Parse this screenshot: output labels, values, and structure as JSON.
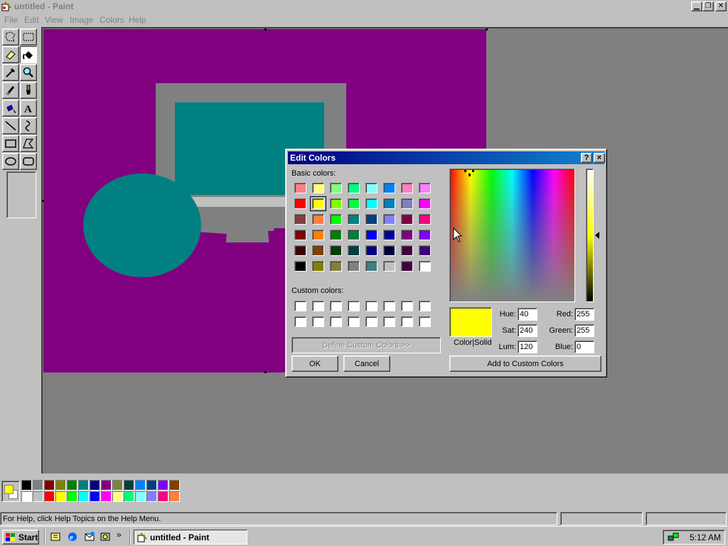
{
  "window": {
    "title": "untitled - Paint",
    "menu": [
      "File",
      "Edit",
      "View",
      "Image",
      "Colors",
      "Help"
    ]
  },
  "toolbox": {
    "tools": [
      "free-form-select",
      "select",
      "eraser",
      "fill-with-color",
      "pick-color",
      "magnifier",
      "pencil",
      "brush",
      "airbrush",
      "text",
      "line",
      "curve",
      "rectangle",
      "polygon",
      "ellipse",
      "rounded-rectangle"
    ],
    "active_tool": "fill-with-color"
  },
  "canvas": {
    "background_color": "#800080",
    "shapes": [
      {
        "name": "monitor-frame",
        "color": "#808080"
      },
      {
        "name": "monitor-screen",
        "color": "#008080"
      },
      {
        "name": "monitor-base",
        "color": "#808080"
      },
      {
        "name": "circle",
        "color": "#008080"
      }
    ]
  },
  "colorbox": {
    "foreground": "#ffff00",
    "background": "#ffffff",
    "top_row": [
      "#000000",
      "#808080",
      "#800000",
      "#808000",
      "#008000",
      "#008080",
      "#000080",
      "#800080",
      "#808040",
      "#004040",
      "#0080ff",
      "#004080",
      "#8000ff",
      "#804000"
    ],
    "bottom_row": [
      "#ffffff",
      "#c0c0c0",
      "#ff0000",
      "#ffff00",
      "#00ff00",
      "#00ffff",
      "#0000ff",
      "#ff00ff",
      "#ffff80",
      "#00ff80",
      "#80ffff",
      "#8080ff",
      "#ff0080",
      "#ff8040"
    ]
  },
  "statusbar": {
    "help_text": "For Help, click Help Topics on the Help Menu."
  },
  "taskbar": {
    "start_label": "Start",
    "task_label": "untitled - Paint",
    "clock": "5:12 AM"
  },
  "dialog": {
    "title": "Edit Colors",
    "basic_colors_label": "Basic colors:",
    "custom_colors_label": "Custom colors:",
    "basic_colors": [
      [
        "#ff8080",
        "#ffff80",
        "#80ff80",
        "#00ff80",
        "#80ffff",
        "#0080ff",
        "#ff80c0",
        "#ff80ff"
      ],
      [
        "#ff0000",
        "#ffff00",
        "#80ff00",
        "#00ff40",
        "#00ffff",
        "#0080c0",
        "#8080c0",
        "#ff00ff"
      ],
      [
        "#804040",
        "#ff8040",
        "#00ff00",
        "#008080",
        "#004080",
        "#8080ff",
        "#800040",
        "#ff0080"
      ],
      [
        "#800000",
        "#ff8000",
        "#008000",
        "#008040",
        "#0000ff",
        "#0000a0",
        "#800080",
        "#8000ff"
      ],
      [
        "#400000",
        "#804000",
        "#004000",
        "#004040",
        "#000080",
        "#000040",
        "#400040",
        "#400080"
      ],
      [
        "#000000",
        "#808000",
        "#808040",
        "#808080",
        "#408080",
        "#c0c0c0",
        "#400040",
        "#ffffff"
      ]
    ],
    "selected_basic": "#ffff00",
    "define_custom_label": "Define Custom Colors >>",
    "ok_label": "OK",
    "cancel_label": "Cancel",
    "preview_label": "Color|Solid",
    "preview_color": "#ffff00",
    "hue_label": "Hue:",
    "sat_label": "Sat:",
    "lum_label": "Lum:",
    "red_label": "Red:",
    "green_label": "Green:",
    "blue_label": "Blue:",
    "hue": "40",
    "sat": "240",
    "lum": "120",
    "red": "255",
    "green": "255",
    "blue": "0",
    "add_custom_label": "Add to Custom Colors",
    "help_button": "?",
    "close_button": "×"
  }
}
